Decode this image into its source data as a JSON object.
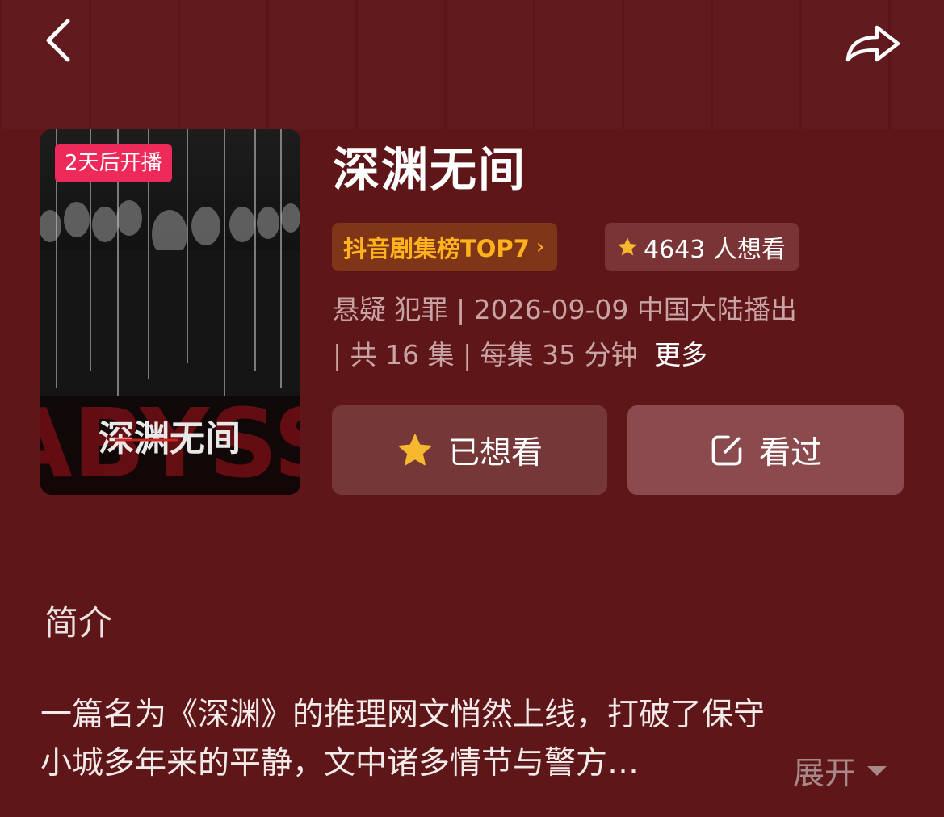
{
  "header": {
    "back_icon": "chevron-left-icon",
    "share_icon": "share-arrow-icon"
  },
  "poster": {
    "badge": "2天后开播",
    "title_art": "深渊无间",
    "logo_text": "ABYSS"
  },
  "show": {
    "title": "深渊无间",
    "rank_label": "抖音剧集榜TOP7",
    "want_count_label": "4643 人想看",
    "meta_line1": "悬疑 犯罪 | 2026-09-09 中国大陆播出",
    "meta_line2": "|  共 16 集 | 每集 35 分钟",
    "more_label": "更多"
  },
  "actions": {
    "want_label": "已想看",
    "seen_label": "看过"
  },
  "intro": {
    "heading": "简介",
    "line1": "一篇名为《深渊》的推理网文悄然上线，打破了保守",
    "line2": "小城多年来的平静，文中诸多情节与警方…",
    "expand_label": "展开"
  },
  "colors": {
    "background": "#5e1619",
    "badge": "#ee2a5a",
    "rank_text": "#ffb21c",
    "star": "#f5b82e"
  }
}
